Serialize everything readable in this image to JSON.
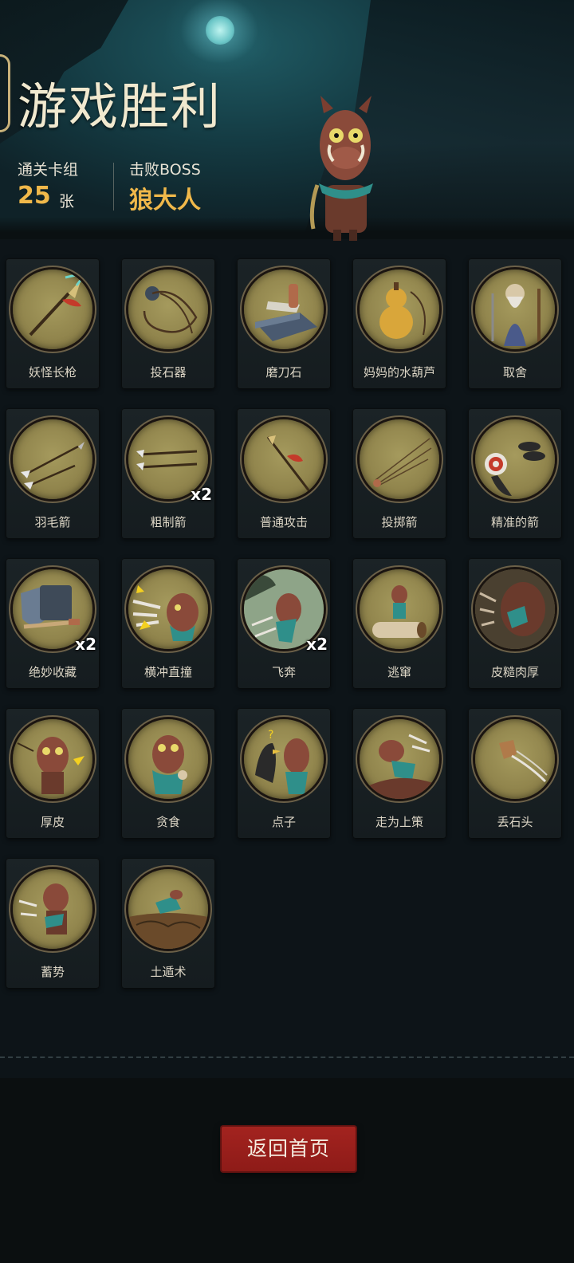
{
  "header": {
    "title": "游戏胜利",
    "deck_label": "通关卡组",
    "deck_count": "25",
    "deck_unit": "张",
    "boss_label": "击败BOSS",
    "boss_name": "狼大人"
  },
  "cards": [
    {
      "name": "妖怪长枪",
      "icon": "spear-icon",
      "mult": ""
    },
    {
      "name": "投石器",
      "icon": "sling-icon",
      "mult": ""
    },
    {
      "name": "磨刀石",
      "icon": "whetstone-icon",
      "mult": ""
    },
    {
      "name": "妈妈的水葫芦",
      "icon": "gourd-icon",
      "mult": ""
    },
    {
      "name": "取舍",
      "icon": "elder-icon",
      "mult": ""
    },
    {
      "name": "羽毛箭",
      "icon": "feather-arrows-icon",
      "mult": ""
    },
    {
      "name": "粗制箭",
      "icon": "crude-arrows-icon",
      "mult": "x2"
    },
    {
      "name": "普通攻击",
      "icon": "normal-attack-icon",
      "mult": ""
    },
    {
      "name": "投掷箭",
      "icon": "thrown-arrows-icon",
      "mult": ""
    },
    {
      "name": "精准的箭",
      "icon": "precise-arrow-icon",
      "mult": ""
    },
    {
      "name": "绝妙收藏",
      "icon": "collection-icon",
      "mult": "x2"
    },
    {
      "name": "横冲直撞",
      "icon": "charge-icon",
      "mult": ""
    },
    {
      "name": "飞奔",
      "icon": "dash-icon",
      "mult": "x2"
    },
    {
      "name": "逃窜",
      "icon": "flee-icon",
      "mult": ""
    },
    {
      "name": "皮糙肉厚",
      "icon": "tough-skin-icon",
      "mult": ""
    },
    {
      "name": "厚皮",
      "icon": "thick-hide-icon",
      "mult": ""
    },
    {
      "name": "贪食",
      "icon": "gluttony-icon",
      "mult": ""
    },
    {
      "name": "点子",
      "icon": "idea-icon",
      "mult": ""
    },
    {
      "name": "走为上策",
      "icon": "retreat-icon",
      "mult": ""
    },
    {
      "name": "丢石头",
      "icon": "throw-rock-icon",
      "mult": ""
    },
    {
      "name": "蓄势",
      "icon": "charge-up-icon",
      "mult": ""
    },
    {
      "name": "土遁术",
      "icon": "earth-escape-icon",
      "mult": ""
    }
  ],
  "footer": {
    "home_label": "返回首页"
  }
}
